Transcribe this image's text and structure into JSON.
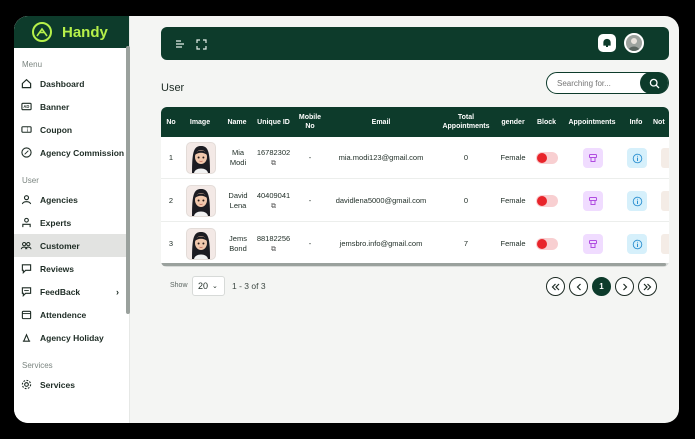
{
  "brand": {
    "name": "Handy"
  },
  "sidebar": {
    "sections": [
      {
        "label": "Menu"
      },
      {
        "label": "User"
      },
      {
        "label": "Services"
      }
    ],
    "items": [
      {
        "label": "Dashboard",
        "icon": "home-icon"
      },
      {
        "label": "Banner",
        "icon": "ad-icon"
      },
      {
        "label": "Coupon",
        "icon": "coupon-icon"
      },
      {
        "label": "Agency Commission",
        "icon": "percent-icon"
      },
      {
        "label": "Agencies",
        "icon": "agencies-icon"
      },
      {
        "label": "Experts",
        "icon": "expert-icon"
      },
      {
        "label": "Customer",
        "icon": "customers-icon",
        "active": true
      },
      {
        "label": "Reviews",
        "icon": "reviews-icon"
      },
      {
        "label": "FeedBack",
        "icon": "feedback-icon"
      },
      {
        "label": "Attendence",
        "icon": "calendar-icon"
      },
      {
        "label": "Agency Holiday",
        "icon": "holiday-icon"
      },
      {
        "label": "Services",
        "icon": "services-icon"
      }
    ]
  },
  "page": {
    "title": "User"
  },
  "search": {
    "placeholder": "Searching for..."
  },
  "table": {
    "headers": [
      "No",
      "Image",
      "Name",
      "Unique ID",
      "Mobile No",
      "Email",
      "Total Appointments",
      "gender",
      "Block",
      "Appointments",
      "Info",
      "Not"
    ],
    "rows": [
      {
        "no": "1",
        "name": "Mia Modi",
        "unique_id": "16782302",
        "mobile": "-",
        "email": "mia.modi123@gmail.com",
        "total": "0",
        "gender": "Female"
      },
      {
        "no": "2",
        "name": "David Lena",
        "unique_id": "40409041",
        "mobile": "-",
        "email": "davidlena5000@gmail.com",
        "total": "0",
        "gender": "Female"
      },
      {
        "no": "3",
        "name": "Jems Bond",
        "unique_id": "88182256",
        "mobile": "-",
        "email": "jemsbro.info@gmail.com",
        "total": "7",
        "gender": "Female"
      }
    ]
  },
  "pagination": {
    "show_label": "Show",
    "page_size": "20",
    "range": "1 - 3 of 3",
    "current_page": "1"
  },
  "colors": {
    "brand_dark": "#0d3b2b",
    "brand_accent": "#b6f04a",
    "toggle_red": "#e8242a"
  }
}
